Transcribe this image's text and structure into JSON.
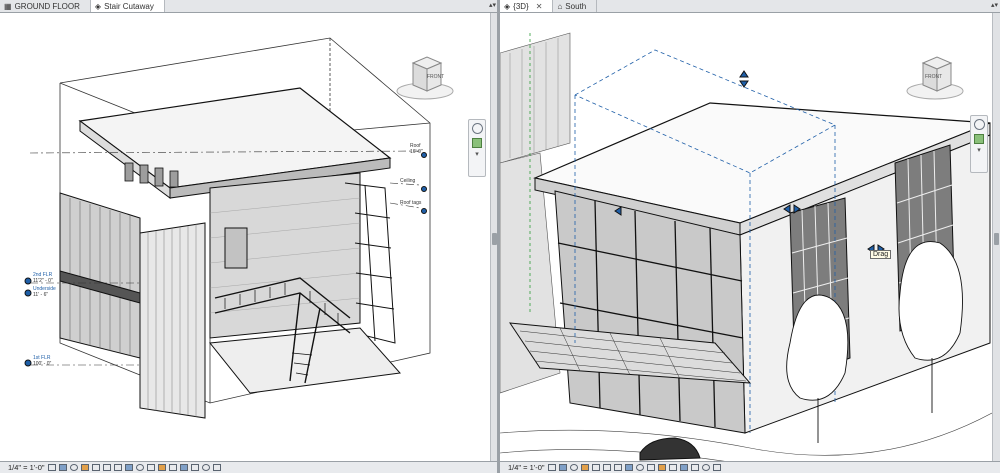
{
  "left_panel": {
    "tabs": [
      {
        "label": "GROUND FLOOR",
        "active": false
      },
      {
        "label": "Stair Cutaway",
        "active": true
      }
    ],
    "view_cube_face": "FRONT",
    "level_markers": [
      {
        "name": "2nd FLR",
        "elev": "11'2\" - 0\""
      },
      {
        "name": "Underside",
        "elev": "11' - 6\""
      },
      {
        "name": "1st FLR",
        "elev": "100' - 0\""
      }
    ],
    "right_tags": [
      "Roof",
      "16'-0\"",
      "Ceiling",
      "Roof tags"
    ],
    "status": {
      "scale": "1/4\" = 1'-0\""
    }
  },
  "right_panel": {
    "tabs": [
      {
        "label": "{3D}",
        "active": true
      },
      {
        "label": "South",
        "active": false
      }
    ],
    "view_cube_face": "FRONT",
    "tooltip": "Drag",
    "status": {
      "scale": "1/4\" = 1'-0\""
    }
  },
  "colors": {
    "ui_bg": "#e4e6e9",
    "view_bg": "#ffffff",
    "tab_bar_border": "#9aa0a6",
    "accent_blue": "#1f5fa8"
  }
}
